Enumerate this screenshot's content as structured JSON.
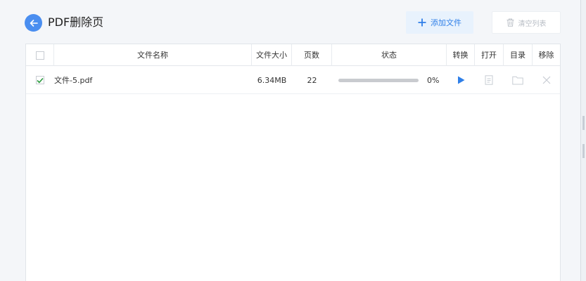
{
  "header": {
    "title": "PDF删除页",
    "add_label": "添加文件",
    "clear_label": "清空列表"
  },
  "table": {
    "columns": [
      "文件名称",
      "文件大小",
      "页数",
      "状态",
      "转换",
      "打开",
      "目录",
      "移除"
    ],
    "rows": [
      {
        "checked": true,
        "name": "文件-5.pdf",
        "size": "6.34MB",
        "pages": "22",
        "progress_percent": 0,
        "progress_text": "0%"
      }
    ]
  },
  "colors": {
    "accent": "#4a8ef0",
    "add_button_bg": "#e8f2fd",
    "check_mark": "#2c9b3e",
    "disabled_icon": "#c7ccd3"
  },
  "icons": {
    "back": "arrow-left-icon",
    "add": "plus-icon",
    "clear": "trash-icon",
    "convert": "play-icon",
    "open": "document-icon",
    "folder": "folder-icon",
    "remove": "close-icon"
  }
}
